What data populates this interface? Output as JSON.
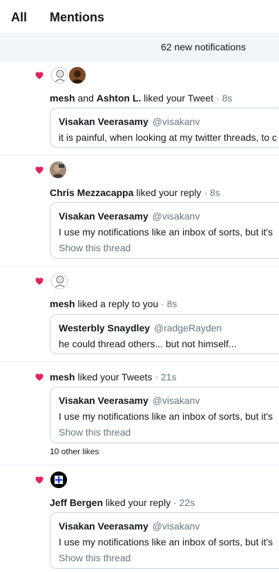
{
  "tabs": {
    "all": "All",
    "mentions": "Mentions"
  },
  "new_bar": {
    "label": "62 new notifications"
  },
  "colors": {
    "heart": "#e0245e",
    "secondary": "#657786",
    "border": "#ccd6dd"
  },
  "notifications": [
    {
      "actor1": "mesh",
      "joiner": "and",
      "actor2": "Ashton L.",
      "action": "liked your Tweet",
      "time": "· 8s",
      "tweet": {
        "name": "Visakan Veerasamy",
        "handle": "@visakanv",
        "text": "it is painful, when looking at my twitter threads, to c"
      }
    },
    {
      "actor1": "Chris Mezzacappa",
      "action": "liked your reply",
      "time": "· 8s",
      "tweet": {
        "name": "Visakan Veerasamy",
        "handle": "@visakanv",
        "text": "I use my notifications like an inbox of sorts, but it's",
        "thread": "Show this thread"
      }
    },
    {
      "actor1": "mesh",
      "action": "liked a reply to you",
      "time": "· 8s",
      "tweet": {
        "name": "Westerbly Snaydley",
        "handle": "@radgeRayden",
        "text": "he could thread others... but not himself..."
      }
    },
    {
      "actor1": "mesh",
      "action": "liked your Tweets",
      "time": "· 21s",
      "tweet": {
        "name": "Visakan Veerasamy",
        "handle": "@visakanv",
        "text": "I use my notifications like an inbox of sorts, but it's",
        "thread": "Show this thread"
      },
      "other_likes": "10 other likes"
    },
    {
      "actor1": "Jeff Bergen",
      "action": "liked your reply",
      "time": "· 22s",
      "tweet": {
        "name": "Visakan Veerasamy",
        "handle": "@visakanv",
        "text": "I use my notifications like an inbox of sorts, but it's",
        "thread": "Show this thread"
      }
    }
  ]
}
